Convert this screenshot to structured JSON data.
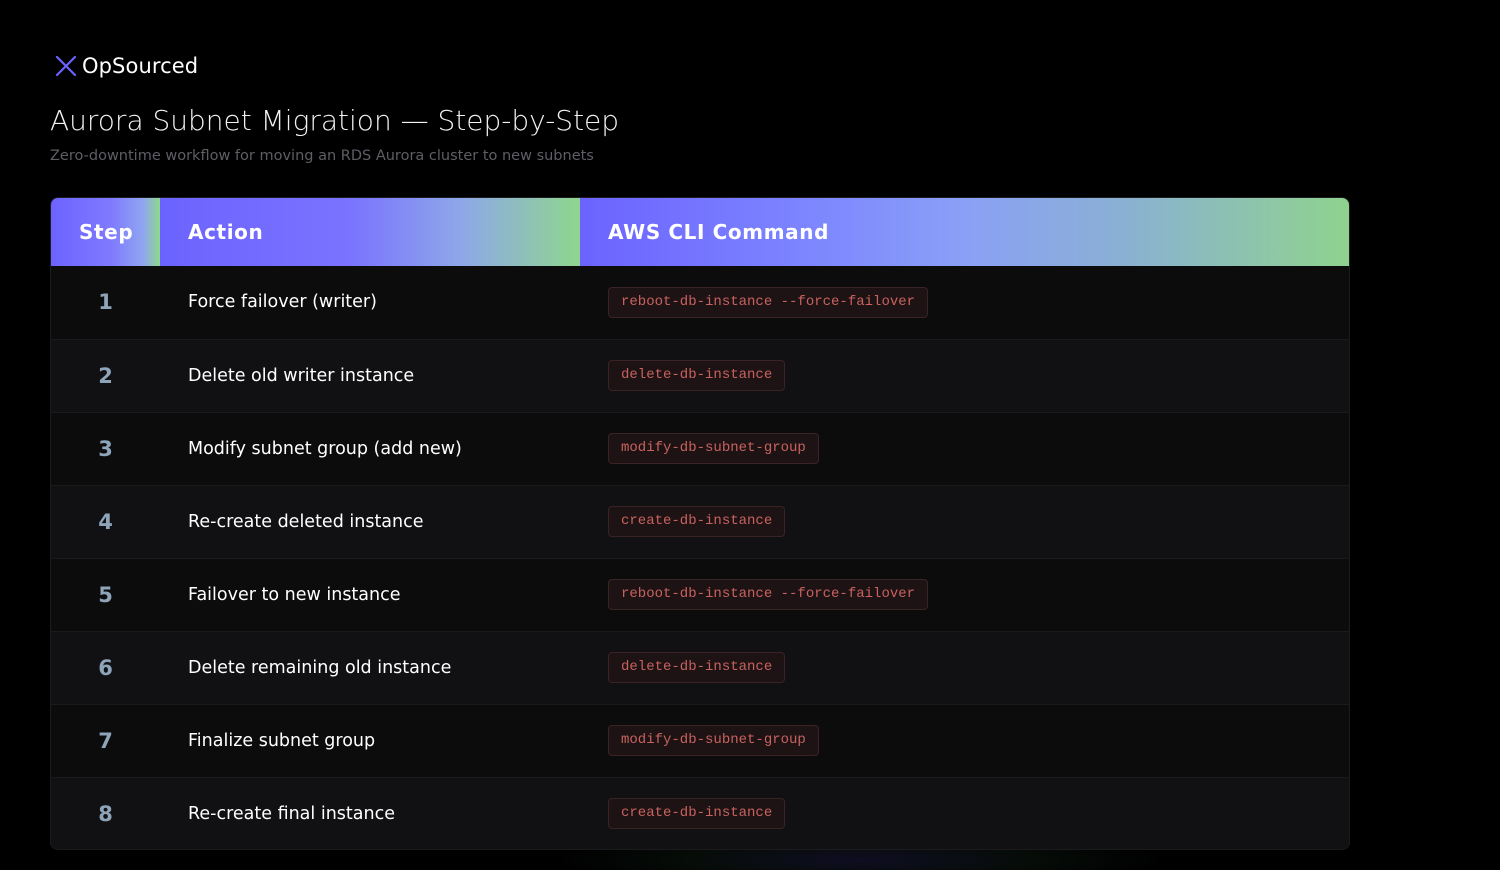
{
  "brand": {
    "name": "OpSourced",
    "mark_color": "#6c63ff"
  },
  "header": {
    "title": "Aurora Subnet Migration — Step-by-Step",
    "subtitle": "Zero-downtime workflow for moving an RDS Aurora cluster to new subnets"
  },
  "table": {
    "columns": [
      "Step",
      "Action",
      "AWS CLI Command"
    ],
    "rows": [
      {
        "step": "1",
        "action": "Force failover (writer)",
        "command": "reboot-db-instance --force-failover"
      },
      {
        "step": "2",
        "action": "Delete old writer instance",
        "command": "delete-db-instance"
      },
      {
        "step": "3",
        "action": "Modify subnet group (add new)",
        "command": "modify-db-subnet-group"
      },
      {
        "step": "4",
        "action": "Re-create deleted instance",
        "command": "create-db-instance"
      },
      {
        "step": "5",
        "action": "Failover to new instance",
        "command": "reboot-db-instance --force-failover"
      },
      {
        "step": "6",
        "action": "Delete remaining old instance",
        "command": "delete-db-instance"
      },
      {
        "step": "7",
        "action": "Finalize subnet group",
        "command": "modify-db-subnet-group"
      },
      {
        "step": "8",
        "action": "Re-create final instance",
        "command": "create-db-instance"
      }
    ]
  },
  "colors": {
    "header_gradient_start": "#6c63ff",
    "header_gradient_end": "#8fd98a",
    "step_number": "#8ea4b8",
    "command_text": "#c8625f"
  },
  "icons": {
    "logo": "x-mark-icon"
  }
}
